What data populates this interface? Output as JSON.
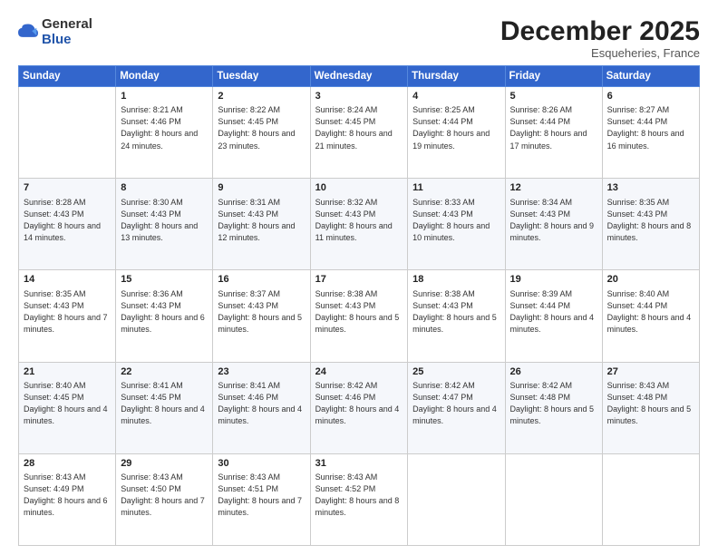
{
  "logo": {
    "general": "General",
    "blue": "Blue"
  },
  "header": {
    "month": "December 2025",
    "location": "Esqueheries, France"
  },
  "weekdays": [
    "Sunday",
    "Monday",
    "Tuesday",
    "Wednesday",
    "Thursday",
    "Friday",
    "Saturday"
  ],
  "weeks": [
    [
      {
        "day": "",
        "sunrise": "",
        "sunset": "",
        "daylight": ""
      },
      {
        "day": "1",
        "sunrise": "Sunrise: 8:21 AM",
        "sunset": "Sunset: 4:46 PM",
        "daylight": "Daylight: 8 hours and 24 minutes."
      },
      {
        "day": "2",
        "sunrise": "Sunrise: 8:22 AM",
        "sunset": "Sunset: 4:45 PM",
        "daylight": "Daylight: 8 hours and 23 minutes."
      },
      {
        "day": "3",
        "sunrise": "Sunrise: 8:24 AM",
        "sunset": "Sunset: 4:45 PM",
        "daylight": "Daylight: 8 hours and 21 minutes."
      },
      {
        "day": "4",
        "sunrise": "Sunrise: 8:25 AM",
        "sunset": "Sunset: 4:44 PM",
        "daylight": "Daylight: 8 hours and 19 minutes."
      },
      {
        "day": "5",
        "sunrise": "Sunrise: 8:26 AM",
        "sunset": "Sunset: 4:44 PM",
        "daylight": "Daylight: 8 hours and 17 minutes."
      },
      {
        "day": "6",
        "sunrise": "Sunrise: 8:27 AM",
        "sunset": "Sunset: 4:44 PM",
        "daylight": "Daylight: 8 hours and 16 minutes."
      }
    ],
    [
      {
        "day": "7",
        "sunrise": "Sunrise: 8:28 AM",
        "sunset": "Sunset: 4:43 PM",
        "daylight": "Daylight: 8 hours and 14 minutes."
      },
      {
        "day": "8",
        "sunrise": "Sunrise: 8:30 AM",
        "sunset": "Sunset: 4:43 PM",
        "daylight": "Daylight: 8 hours and 13 minutes."
      },
      {
        "day": "9",
        "sunrise": "Sunrise: 8:31 AM",
        "sunset": "Sunset: 4:43 PM",
        "daylight": "Daylight: 8 hours and 12 minutes."
      },
      {
        "day": "10",
        "sunrise": "Sunrise: 8:32 AM",
        "sunset": "Sunset: 4:43 PM",
        "daylight": "Daylight: 8 hours and 11 minutes."
      },
      {
        "day": "11",
        "sunrise": "Sunrise: 8:33 AM",
        "sunset": "Sunset: 4:43 PM",
        "daylight": "Daylight: 8 hours and 10 minutes."
      },
      {
        "day": "12",
        "sunrise": "Sunrise: 8:34 AM",
        "sunset": "Sunset: 4:43 PM",
        "daylight": "Daylight: 8 hours and 9 minutes."
      },
      {
        "day": "13",
        "sunrise": "Sunrise: 8:35 AM",
        "sunset": "Sunset: 4:43 PM",
        "daylight": "Daylight: 8 hours and 8 minutes."
      }
    ],
    [
      {
        "day": "14",
        "sunrise": "Sunrise: 8:35 AM",
        "sunset": "Sunset: 4:43 PM",
        "daylight": "Daylight: 8 hours and 7 minutes."
      },
      {
        "day": "15",
        "sunrise": "Sunrise: 8:36 AM",
        "sunset": "Sunset: 4:43 PM",
        "daylight": "Daylight: 8 hours and 6 minutes."
      },
      {
        "day": "16",
        "sunrise": "Sunrise: 8:37 AM",
        "sunset": "Sunset: 4:43 PM",
        "daylight": "Daylight: 8 hours and 5 minutes."
      },
      {
        "day": "17",
        "sunrise": "Sunrise: 8:38 AM",
        "sunset": "Sunset: 4:43 PM",
        "daylight": "Daylight: 8 hours and 5 minutes."
      },
      {
        "day": "18",
        "sunrise": "Sunrise: 8:38 AM",
        "sunset": "Sunset: 4:43 PM",
        "daylight": "Daylight: 8 hours and 5 minutes."
      },
      {
        "day": "19",
        "sunrise": "Sunrise: 8:39 AM",
        "sunset": "Sunset: 4:44 PM",
        "daylight": "Daylight: 8 hours and 4 minutes."
      },
      {
        "day": "20",
        "sunrise": "Sunrise: 8:40 AM",
        "sunset": "Sunset: 4:44 PM",
        "daylight": "Daylight: 8 hours and 4 minutes."
      }
    ],
    [
      {
        "day": "21",
        "sunrise": "Sunrise: 8:40 AM",
        "sunset": "Sunset: 4:45 PM",
        "daylight": "Daylight: 8 hours and 4 minutes."
      },
      {
        "day": "22",
        "sunrise": "Sunrise: 8:41 AM",
        "sunset": "Sunset: 4:45 PM",
        "daylight": "Daylight: 8 hours and 4 minutes."
      },
      {
        "day": "23",
        "sunrise": "Sunrise: 8:41 AM",
        "sunset": "Sunset: 4:46 PM",
        "daylight": "Daylight: 8 hours and 4 minutes."
      },
      {
        "day": "24",
        "sunrise": "Sunrise: 8:42 AM",
        "sunset": "Sunset: 4:46 PM",
        "daylight": "Daylight: 8 hours and 4 minutes."
      },
      {
        "day": "25",
        "sunrise": "Sunrise: 8:42 AM",
        "sunset": "Sunset: 4:47 PM",
        "daylight": "Daylight: 8 hours and 4 minutes."
      },
      {
        "day": "26",
        "sunrise": "Sunrise: 8:42 AM",
        "sunset": "Sunset: 4:48 PM",
        "daylight": "Daylight: 8 hours and 5 minutes."
      },
      {
        "day": "27",
        "sunrise": "Sunrise: 8:43 AM",
        "sunset": "Sunset: 4:48 PM",
        "daylight": "Daylight: 8 hours and 5 minutes."
      }
    ],
    [
      {
        "day": "28",
        "sunrise": "Sunrise: 8:43 AM",
        "sunset": "Sunset: 4:49 PM",
        "daylight": "Daylight: 8 hours and 6 minutes."
      },
      {
        "day": "29",
        "sunrise": "Sunrise: 8:43 AM",
        "sunset": "Sunset: 4:50 PM",
        "daylight": "Daylight: 8 hours and 7 minutes."
      },
      {
        "day": "30",
        "sunrise": "Sunrise: 8:43 AM",
        "sunset": "Sunset: 4:51 PM",
        "daylight": "Daylight: 8 hours and 7 minutes."
      },
      {
        "day": "31",
        "sunrise": "Sunrise: 8:43 AM",
        "sunset": "Sunset: 4:52 PM",
        "daylight": "Daylight: 8 hours and 8 minutes."
      },
      {
        "day": "",
        "sunrise": "",
        "sunset": "",
        "daylight": ""
      },
      {
        "day": "",
        "sunrise": "",
        "sunset": "",
        "daylight": ""
      },
      {
        "day": "",
        "sunrise": "",
        "sunset": "",
        "daylight": ""
      }
    ]
  ]
}
